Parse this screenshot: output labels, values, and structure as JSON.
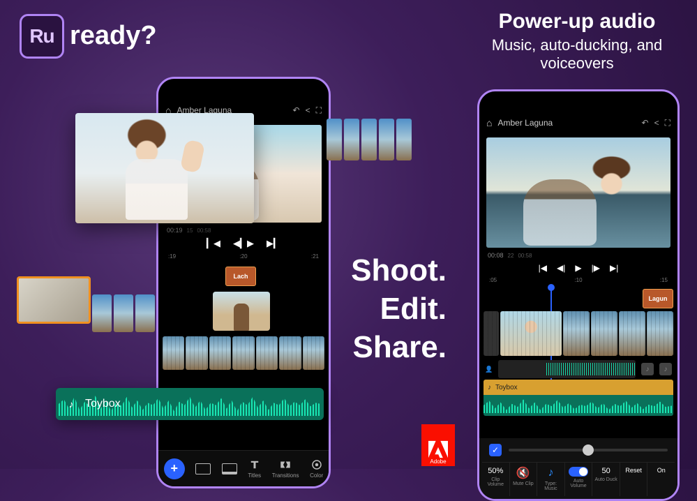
{
  "marketing": {
    "app_icon_label": "Ru",
    "ready": "ready?",
    "tagline": [
      "Shoot.",
      "Edit.",
      "Share."
    ],
    "headline_title": "Power-up audio",
    "headline_sub": "Music, auto-ducking, and voiceovers",
    "adobe_label": "Adobe"
  },
  "phone1": {
    "project_name": "Amber Laguna",
    "time_current": "00:19",
    "time_frame": "15",
    "time_total": "00:58",
    "ruler": [
      ":19",
      ":20",
      ":21"
    ],
    "title_clip": "Lach",
    "toolbar": [
      "Titles",
      "Transitions",
      "Color"
    ]
  },
  "phone2": {
    "project_name": "Amber Laguna",
    "time_current": "00:08",
    "time_frame": "22",
    "time_total": "00:58",
    "ruler": [
      ":05",
      ":10",
      ":15"
    ],
    "title_clip": "Lagun",
    "audio_track_name": "Toybox",
    "params": [
      {
        "val": "50%",
        "lbl": "Clip Volume"
      },
      {
        "val": "icon:mute",
        "lbl": "Mute Clip"
      },
      {
        "val": "icon:music-on",
        "lbl": "Type: Music"
      },
      {
        "val": "icon:toggle-on",
        "lbl": "Auto Volume"
      },
      {
        "val": "50",
        "lbl": "Auto Duck"
      },
      {
        "val": "Reset",
        "lbl": ""
      },
      {
        "val": "On",
        "lbl": ""
      }
    ]
  },
  "floaters": {
    "audio_name": "Toybox"
  }
}
